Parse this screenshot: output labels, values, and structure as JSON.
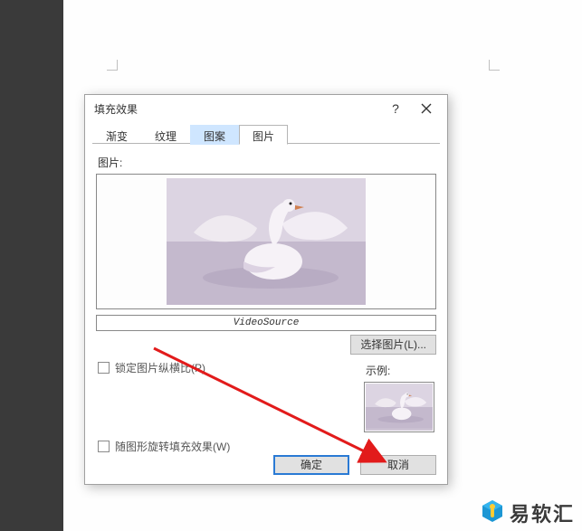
{
  "dialog": {
    "title": "填充效果",
    "tabs": [
      "渐变",
      "纹理",
      "图案",
      "图片"
    ],
    "active_tab_index": 3,
    "picture": {
      "label": "图片:",
      "source_name": "VideoSource",
      "select_button": "选择图片(L)..."
    },
    "lock_aspect": {
      "label": "锁定图片纵横比(P)",
      "checked": false
    },
    "rotate_with_shape": {
      "label": "随图形旋转填充效果(W)",
      "checked": false
    },
    "example_label": "示例:",
    "buttons": {
      "ok": "确定",
      "cancel": "取消"
    }
  },
  "watermark": {
    "text": "易软汇"
  }
}
